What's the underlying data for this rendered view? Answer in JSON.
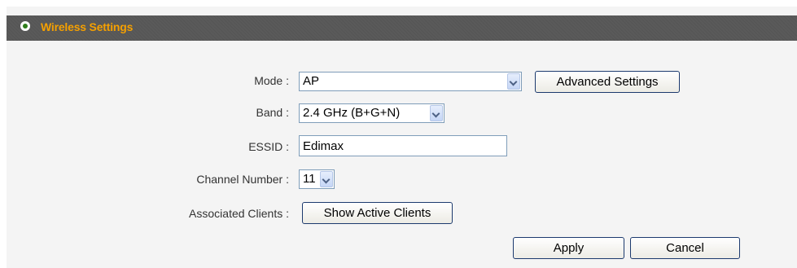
{
  "header": {
    "title": "Wireless Settings",
    "bullet_icon": "radio-bullet-icon"
  },
  "form": {
    "mode": {
      "label": "Mode :",
      "value": "AP"
    },
    "band": {
      "label": "Band :",
      "value": "2.4 GHz (B+G+N)"
    },
    "essid": {
      "label": "ESSID :",
      "value": "Edimax"
    },
    "channel": {
      "label": "Channel Number :",
      "value": "11"
    },
    "clients": {
      "label": "Associated Clients :"
    }
  },
  "buttons": {
    "advanced_settings": "Advanced Settings",
    "show_active_clients": "Show Active Clients",
    "apply": "Apply",
    "cancel": "Cancel"
  },
  "colors": {
    "title_text": "#f5a000",
    "title_bar": "#5a5a5a",
    "panel_bg": "#f4f4f4"
  }
}
